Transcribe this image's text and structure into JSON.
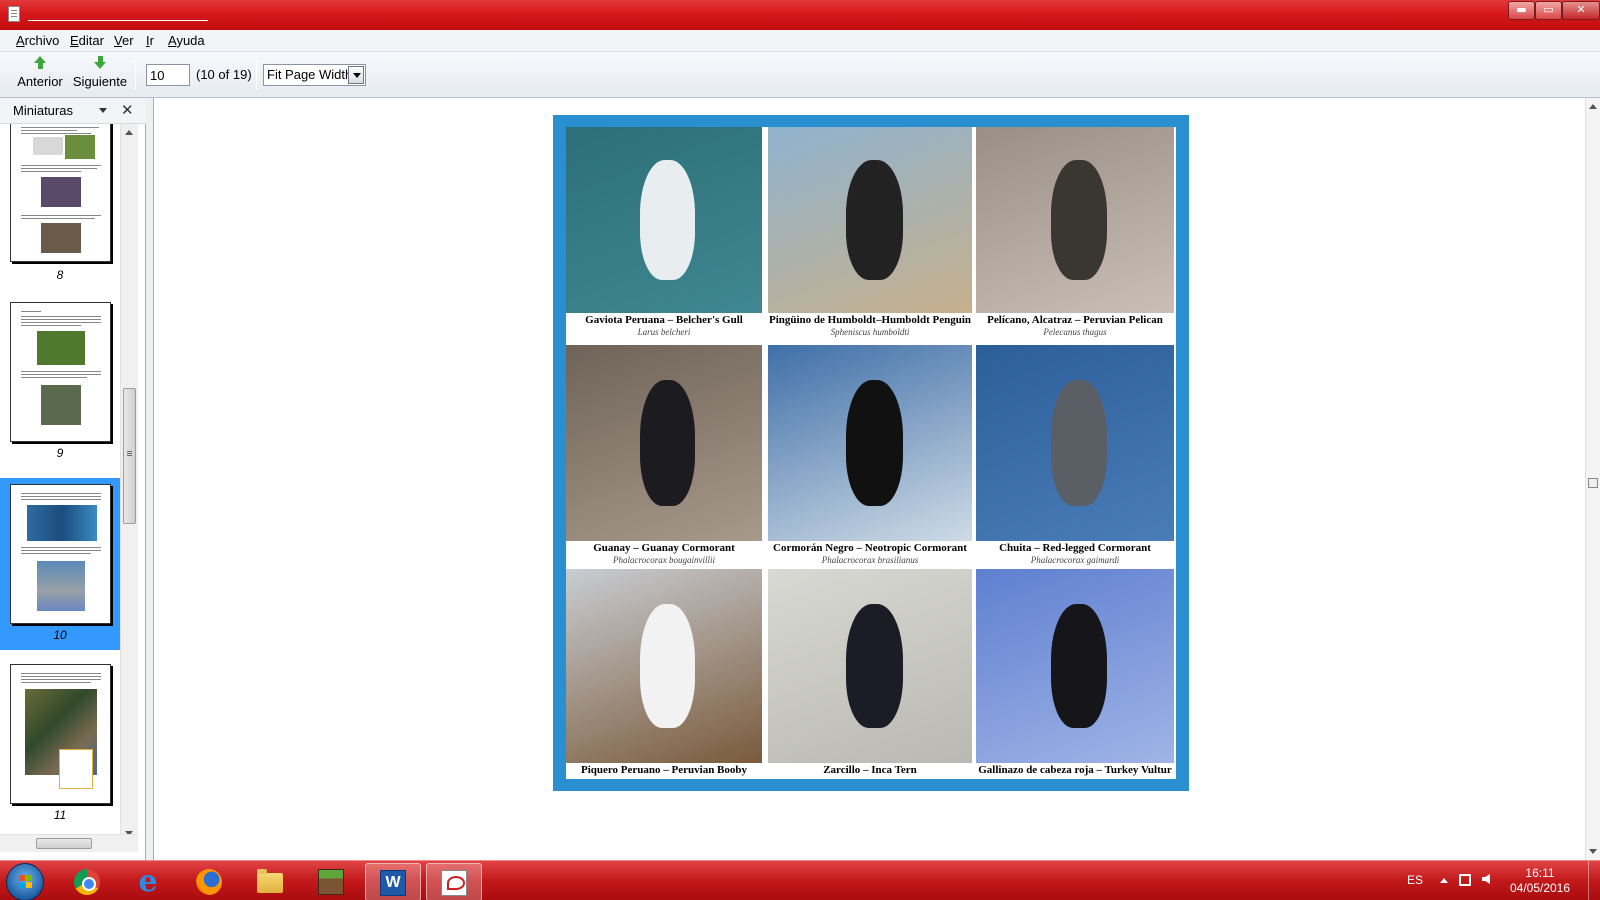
{
  "window": {
    "title": "",
    "controls": {
      "minimize": "▬",
      "maximize": "▭",
      "close": "✕"
    }
  },
  "menu": {
    "items": [
      "Archivo",
      "Editar",
      "Ver",
      "Ir",
      "Ayuda"
    ]
  },
  "toolbar": {
    "prev_label": "Anterior",
    "next_label": "Siguiente",
    "page_value": "10",
    "page_count": "(10 of 19)",
    "zoom_value": "Fit Page Width",
    "zoom_options": [
      "Fit Page Width"
    ]
  },
  "sidebar": {
    "title": "Miniaturas",
    "close_icon": "close-icon",
    "thumbnails": [
      {
        "page": "8",
        "selected": false
      },
      {
        "page": "9",
        "selected": false
      },
      {
        "page": "10",
        "selected": true
      },
      {
        "page": "11",
        "selected": false
      }
    ]
  },
  "document": {
    "birds": [
      {
        "common": "Gaviota Peruana – Belcher's Gull",
        "latin": "Larus belcheri",
        "colors": [
          "#2d6f78",
          "#3f8792",
          "#e8eef0"
        ]
      },
      {
        "common": "Pingüino de Humboldt–Humboldt Penguin",
        "latin": "Spheniscus humboldti",
        "colors": [
          "#8fb3cf",
          "#c7b08c",
          "#222222"
        ]
      },
      {
        "common": "Pelícano, Alcatraz – Peruvian Pelican",
        "latin": "Pelecanus thagus",
        "colors": [
          "#9a8f86",
          "#c9bfb6",
          "#3a3632"
        ]
      },
      {
        "common": "Guanay – Guanay Cormorant",
        "latin": "Phalacrocorax bougainvillii",
        "colors": [
          "#6f6258",
          "#a89a8a",
          "#1c1c20"
        ]
      },
      {
        "common": "Cormorán Negro – Neotropic Cormorant",
        "latin": "Phalacrocorax brasilianus",
        "colors": [
          "#3f6fa8",
          "#cfdbe6",
          "#111111"
        ]
      },
      {
        "common": "Chuita – Red-legged Cormorant",
        "latin": "Phalacrocorax gaimardi",
        "colors": [
          "#2c5f9a",
          "#4a7db8",
          "#5a5f66"
        ]
      },
      {
        "common": "Piquero Peruano – Peruvian Booby",
        "latin": "",
        "colors": [
          "#c9cdd3",
          "#7a5a3a",
          "#f2f2f2"
        ]
      },
      {
        "common": "Zarcillo – Inca Tern",
        "latin": "",
        "colors": [
          "#d8d8d4",
          "#b9b8b2",
          "#1a1d25"
        ]
      },
      {
        "common": "Gallinazo de cabeza roja – Turkey Vultur",
        "latin": "",
        "colors": [
          "#5f7fd0",
          "#9fb4e6",
          "#16161a"
        ]
      }
    ]
  },
  "taskbar": {
    "apps": [
      "chrome-icon",
      "ie-icon",
      "firefox-icon",
      "folder-icon",
      "minecraft-icon",
      "word-icon",
      "reader-icon"
    ],
    "word_glyph": "W",
    "ie_glyph": "e",
    "language": "ES",
    "time": "16:11",
    "date": "04/05/2016"
  }
}
